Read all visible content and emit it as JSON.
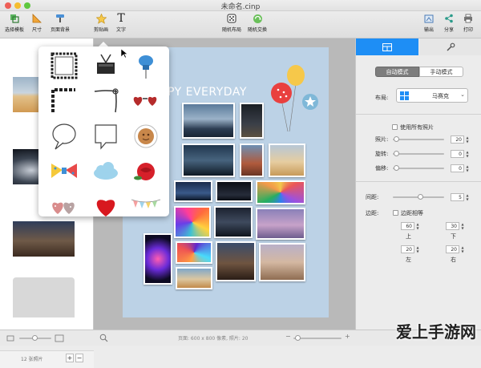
{
  "window": {
    "title": "未命名.cinp"
  },
  "toolbar": {
    "items": [
      {
        "label": "选择模板",
        "icon": "template-icon"
      },
      {
        "label": "尺寸",
        "icon": "ruler-icon"
      },
      {
        "label": "页面背景",
        "icon": "paint-roller-icon"
      },
      {
        "label": "剪贴画",
        "icon": "star-icon"
      },
      {
        "label": "文字",
        "icon": "text-icon"
      },
      {
        "label": "随机布局",
        "icon": "dice-icon"
      },
      {
        "label": "随机交换",
        "icon": "shuffle-icon"
      },
      {
        "label": "输出",
        "icon": "export-icon"
      },
      {
        "label": "分享",
        "icon": "share-icon"
      },
      {
        "label": "打印",
        "icon": "print-icon"
      }
    ]
  },
  "left_panel": {
    "photo_count": "12 张照片",
    "add_label": "+",
    "remove_label": "−"
  },
  "canvas": {
    "headline": "PY EVERYDAY"
  },
  "clipart": {
    "items": [
      "ornate-frame",
      "binder-clip",
      "push-pin",
      "corner-frame",
      "corner-ornament",
      "heart-sunglasses",
      "speech-bubble",
      "paper-note",
      "coffee-cup",
      "bow-tie",
      "cloud",
      "rose",
      "patterned-hearts",
      "red-heart",
      "bunting-flags"
    ]
  },
  "right_panel": {
    "mode_auto": "自动模式",
    "mode_manual": "手动模式",
    "layout_label": "布局:",
    "layout_value": "马赛克",
    "use_all_photos": "使用所有照片",
    "photos_label": "照片:",
    "photos_value": "20",
    "rotate_label": "旋转:",
    "rotate_value": "0",
    "tilt_label": "偏移:",
    "tilt_value": "0",
    "spacing_label": "间距:",
    "spacing_value": "5",
    "margin_label": "边距:",
    "margin_equal": "边距相等",
    "margin_top": "60",
    "margin_top_label": "上",
    "margin_bottom": "30",
    "margin_bottom_label": "下",
    "margin_left": "20",
    "margin_left_label": "左",
    "margin_right": "20",
    "margin_right_label": "右"
  },
  "status": {
    "page_info": "页面: 600 x 800 像素, 照片: 20"
  },
  "watermark": "爱上手游网",
  "colors": {
    "accent": "#1e8ef5",
    "page_bg": "#bcd2e6",
    "canvas_bg": "#b9b9b9"
  }
}
